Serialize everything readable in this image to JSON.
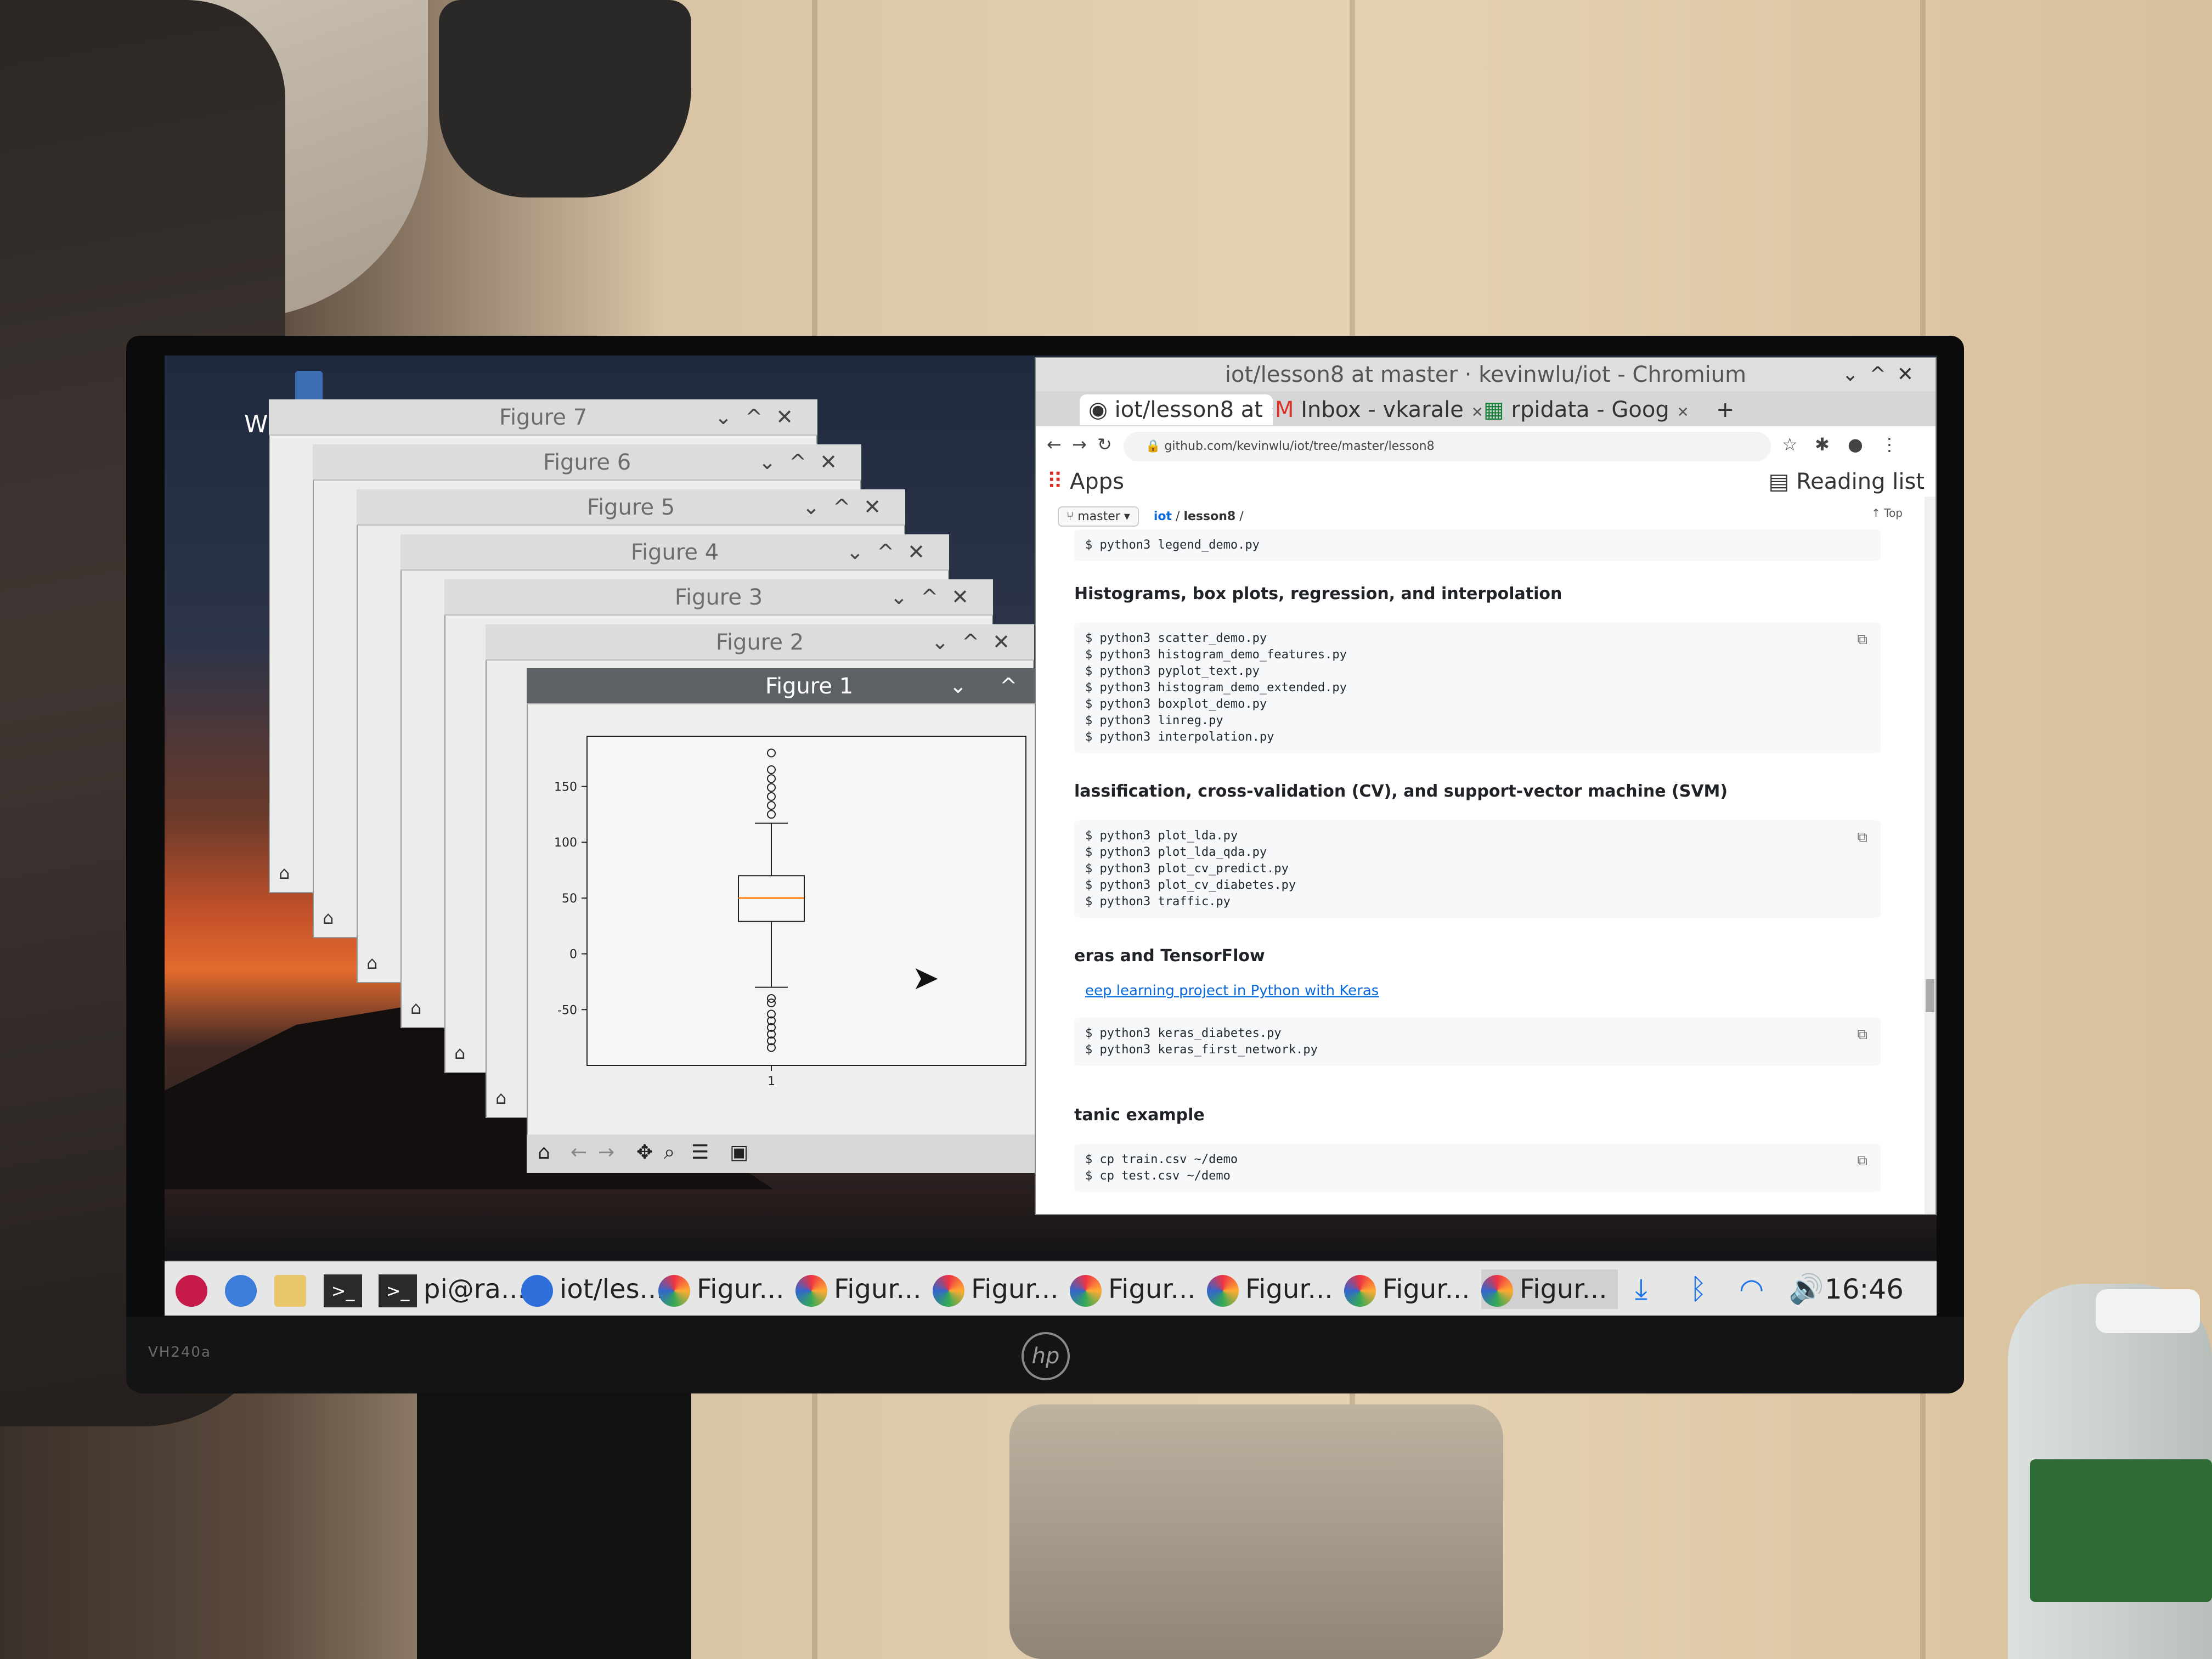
{
  "desktop": {
    "desktop_label": "W"
  },
  "monitor": {
    "model": "VH240a",
    "brand": "hp"
  },
  "figure_windows": [
    {
      "title": "Figure 7"
    },
    {
      "title": "Figure 6"
    },
    {
      "title": "Figure 5"
    },
    {
      "title": "Figure 4"
    },
    {
      "title": "Figure 3"
    },
    {
      "title": "Figure 2"
    }
  ],
  "figure1": {
    "title": "Figure 1",
    "window_controls": "⌄ ^ ✕",
    "chart_data": {
      "type": "box",
      "categories": [
        "1"
      ],
      "yticks": [
        150,
        100,
        50,
        0,
        -50
      ],
      "ylim": [
        -100,
        195
      ],
      "box": {
        "q1": 29,
        "median": 50,
        "q3": 70,
        "whisker_low": -30,
        "whisker_high": 117
      },
      "outliers_high": [
        125,
        133,
        141,
        149,
        157,
        165,
        180
      ],
      "outliers_low": [
        -40,
        -44,
        -54,
        -60,
        -66,
        -72,
        -78,
        -84
      ],
      "median_color": "#ff7f0e"
    },
    "toolbar": [
      "home-icon",
      "back-icon",
      "forward-icon",
      "pan-icon",
      "zoom-icon",
      "configure-icon",
      "save-icon"
    ]
  },
  "browser": {
    "window_title": "iot/lesson8 at master · kevinwlu/iot - Chromium",
    "tabs": [
      {
        "label": "iot/lesson8 at"
      },
      {
        "label": "Inbox - vkarale"
      },
      {
        "label": "rpidata - Goog"
      }
    ],
    "new_tab": "+",
    "url": "github.com/kevinwlu/iot/tree/master/lesson8",
    "bookmarks": {
      "apps": "Apps",
      "reading_list": "Reading list"
    },
    "breadcrumb": {
      "branch": "master",
      "path_repo": "iot",
      "path_sep": "/",
      "path_dir": "lesson8",
      "path_trailing": "/",
      "top": "Top"
    },
    "sections": [
      {
        "type": "code",
        "lines": [
          "$ python3 legend_demo.py"
        ]
      },
      {
        "type": "heading",
        "text": "Histograms, box plots, regression, and interpolation"
      },
      {
        "type": "code",
        "lines": [
          "$ python3 scatter_demo.py",
          "$ python3 histogram_demo_features.py",
          "$ python3 pyplot_text.py",
          "$ python3 histogram_demo_extended.py",
          "$ python3 boxplot_demo.py",
          "$ python3 linreg.py",
          "$ python3 interpolation.py"
        ]
      },
      {
        "type": "heading",
        "text": "lassification, cross-validation (CV), and support-vector machine (SVM)"
      },
      {
        "type": "code",
        "lines": [
          "$ python3 plot_lda.py",
          "$ python3 plot_lda_qda.py",
          "$ python3 plot_cv_predict.py",
          "$ python3 plot_cv_diabetes.py",
          "$ python3 traffic.py"
        ]
      },
      {
        "type": "heading",
        "text": "eras and TensorFlow"
      },
      {
        "type": "link",
        "text": "eep learning project in Python with Keras"
      },
      {
        "type": "code",
        "lines": [
          "$ python3 keras_diabetes.py",
          "$ python3 keras_first_network.py"
        ]
      },
      {
        "type": "heading",
        "text": "tanic example"
      },
      {
        "type": "code",
        "lines": [
          "$ cp train.csv ~/demo",
          "$ cp test.csv ~/demo"
        ]
      }
    ]
  },
  "taskbar": {
    "items": [
      {
        "label": "pi@ra..."
      },
      {
        "label": "iot/les..."
      },
      {
        "label": "Figur..."
      },
      {
        "label": "Figur..."
      },
      {
        "label": "Figur..."
      },
      {
        "label": "Figur..."
      },
      {
        "label": "Figur..."
      },
      {
        "label": "Figur..."
      },
      {
        "label": "Figur..."
      }
    ],
    "clock": "16:46"
  }
}
